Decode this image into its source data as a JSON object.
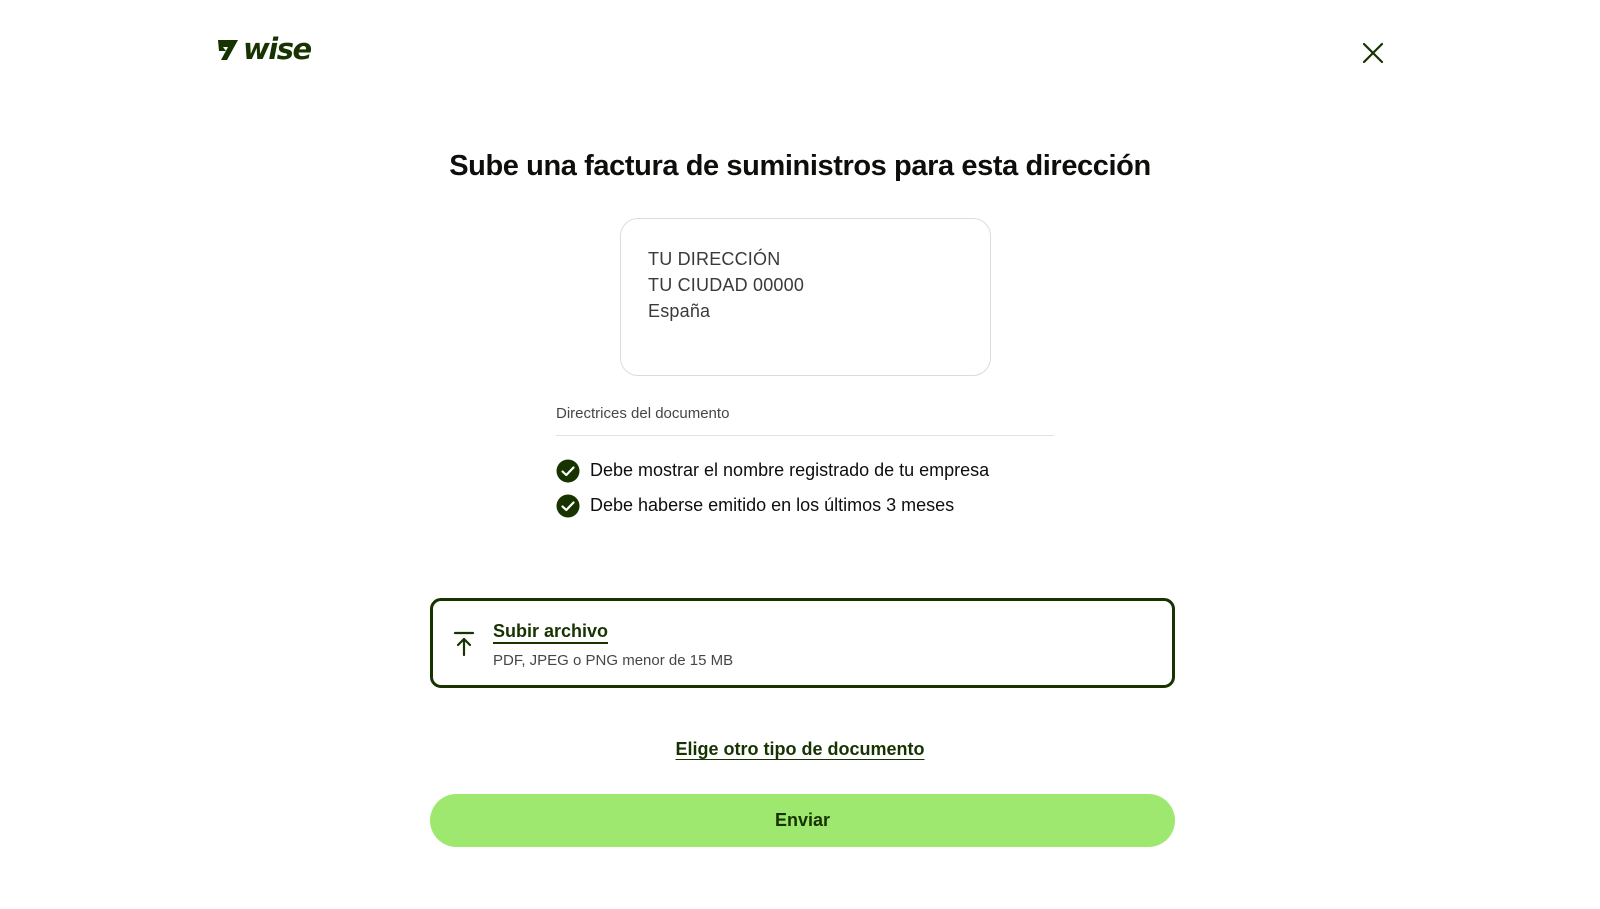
{
  "brand": {
    "name": "wise",
    "accent_color": "#163300",
    "primary_button_color": "#9fe870"
  },
  "header": {
    "close_icon": "close-icon"
  },
  "main": {
    "title": "Sube una factura de suministros para esta dirección",
    "address": {
      "line1": "TU DIRECCIÓN",
      "line2": "TU CIUDAD 00000",
      "line3": "España"
    },
    "guidelines": {
      "title": "Directrices del documento",
      "items": [
        {
          "icon": "check-circle-icon",
          "text": "Debe mostrar el nombre registrado de tu empresa"
        },
        {
          "icon": "check-circle-icon",
          "text": "Debe haberse emitido en los últimos 3 meses"
        }
      ]
    },
    "upload": {
      "icon": "upload-icon",
      "label": "Subir archivo",
      "hint": "PDF, JPEG o PNG menor de 15 MB"
    },
    "alternate_link": "Elige otro tipo de documento",
    "submit_label": "Enviar"
  }
}
